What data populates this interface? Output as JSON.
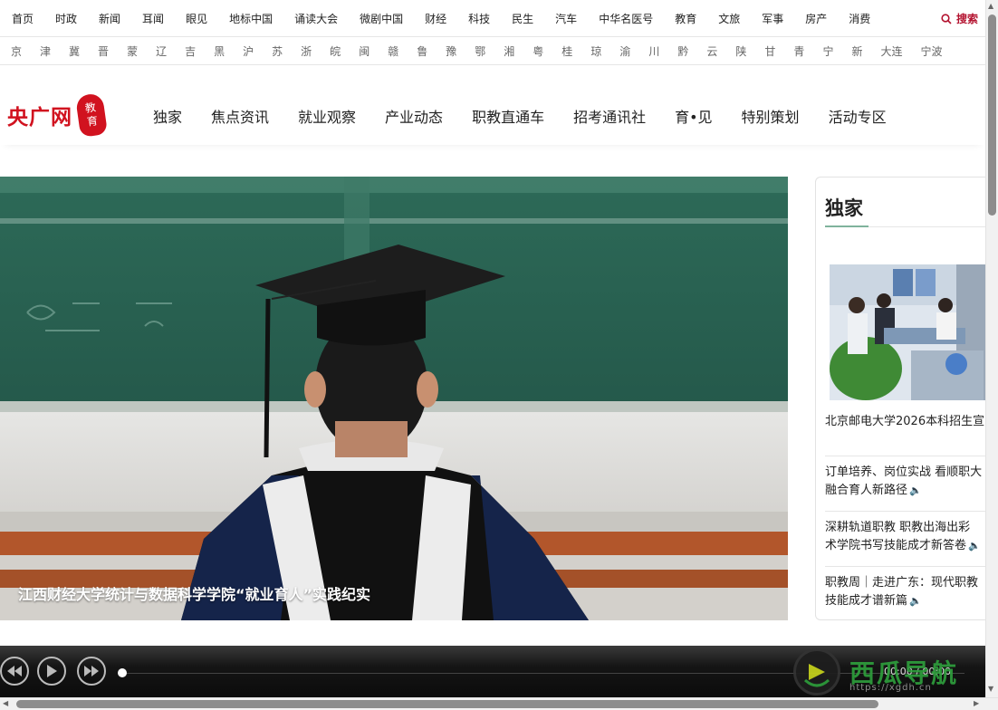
{
  "topbar": {
    "links": [
      "首页",
      "时政",
      "新闻",
      "耳闻",
      "眼见",
      "地标中国",
      "诵读大会",
      "微剧中国",
      "财经",
      "科技",
      "民生",
      "汽车",
      "中华名医号",
      "教育",
      "文旅",
      "军事",
      "房产",
      "消费"
    ],
    "search_label": "搜索",
    "accent": "#b3112e"
  },
  "provinces": [
    "京",
    "津",
    "冀",
    "晋",
    "蒙",
    "辽",
    "吉",
    "黑",
    "沪",
    "苏",
    "浙",
    "皖",
    "闽",
    "赣",
    "鲁",
    "豫",
    "鄂",
    "湘",
    "粤",
    "桂",
    "琼",
    "渝",
    "川",
    "黔",
    "云",
    "陕",
    "甘",
    "青",
    "宁",
    "新",
    "大连",
    "宁波"
  ],
  "brand": {
    "name": "央广网",
    "seal_top": "教",
    "seal_bottom": "育",
    "color": "#d1121f"
  },
  "mainnav": [
    "独家",
    "焦点资讯",
    "就业观察",
    "产业动态",
    "职教直通车",
    "招考通讯社",
    "育•见",
    "特别策划",
    "活动专区"
  ],
  "hero": {
    "caption": "江西财经大学统计与数据科学学院“就业育人”实践纪实"
  },
  "side": {
    "title": "独家",
    "pic_title": "北京邮电大学2026本科招生宣",
    "items": [
      {
        "line1": "订单培养、岗位实战 看顺职大",
        "line2": "融合育人新路径"
      },
      {
        "line1": "深耕轨道职教 职教出海出彩",
        "line2": "术学院书写技能成才新答卷"
      },
      {
        "line1": "职教周｜走进广东：现代职教",
        "line2": "技能成才谱新篇"
      }
    ]
  },
  "player": {
    "time": "00:00 / 00:00"
  },
  "watermark": {
    "text": "西瓜导航",
    "url": "https://xgdh.cn"
  }
}
